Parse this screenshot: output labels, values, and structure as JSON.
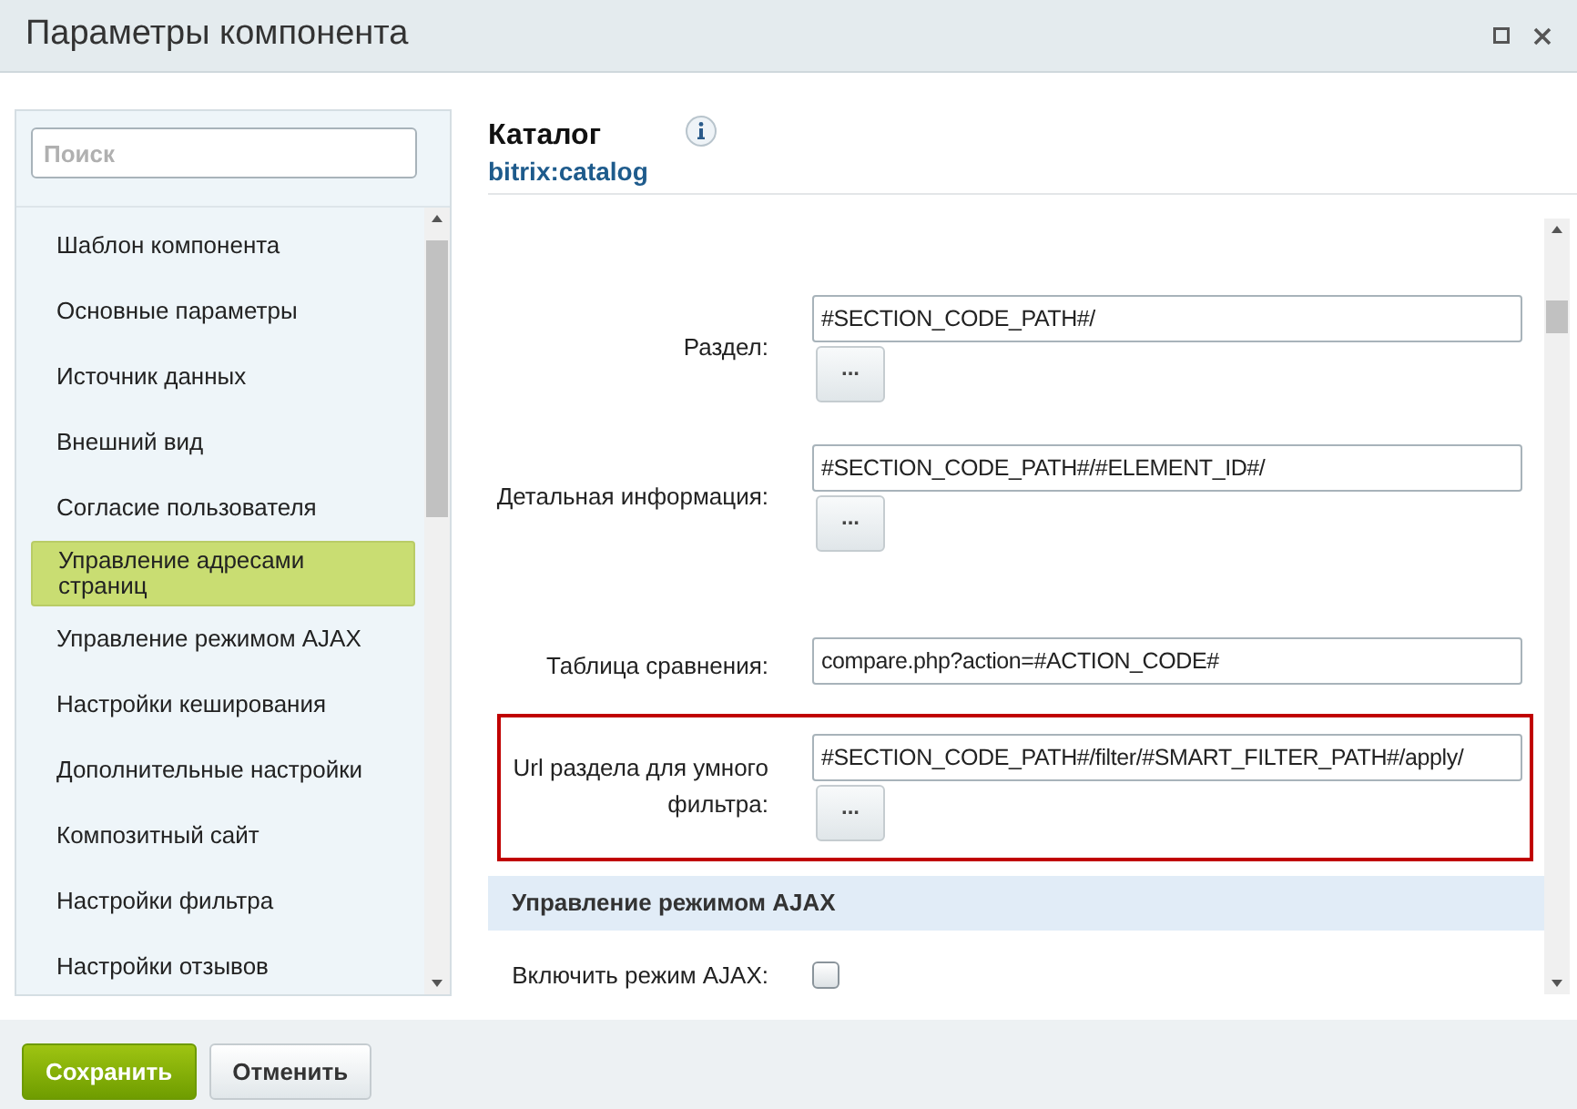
{
  "window": {
    "title": "Параметры компонента"
  },
  "sidebar": {
    "search": {
      "placeholder": "Поиск"
    },
    "items": [
      {
        "label": "Шаблон компонента",
        "selected": false
      },
      {
        "label": "Основные параметры",
        "selected": false
      },
      {
        "label": "Источник данных",
        "selected": false
      },
      {
        "label": "Внешний вид",
        "selected": false
      },
      {
        "label": "Согласие пользователя",
        "selected": false
      },
      {
        "label": "Управление адресами страниц",
        "selected": true
      },
      {
        "label": "Управление режимом AJAX",
        "selected": false
      },
      {
        "label": "Настройки кеширования",
        "selected": false
      },
      {
        "label": "Дополнительные настройки",
        "selected": false
      },
      {
        "label": "Композитный сайт",
        "selected": false
      },
      {
        "label": "Настройки фильтра",
        "selected": false
      },
      {
        "label": "Настройки отзывов",
        "selected": false
      }
    ]
  },
  "component": {
    "name": "Каталог",
    "code": "bitrix:catalog"
  },
  "rows": [
    {
      "kind": "field",
      "label": "Раздел:",
      "value": "#SECTION_CODE_PATH#/",
      "button": "...",
      "highlighted": false
    },
    {
      "kind": "field",
      "label": "Детальная информация:",
      "value": "#SECTION_CODE_PATH#/#ELEMENT_ID#/",
      "button": "...",
      "highlighted": false
    },
    {
      "kind": "field",
      "label": "Таблица сравнения:",
      "value": "compare.php?action=#ACTION_CODE#",
      "highlighted": false
    },
    {
      "kind": "field",
      "label": "Url раздела для умного фильтра:",
      "value": "#SECTION_CODE_PATH#/filter/#SMART_FILTER_PATH#/apply/",
      "button": "...",
      "highlighted": true
    },
    {
      "kind": "header",
      "label": "Управление режимом AJAX"
    },
    {
      "kind": "checkbox",
      "label": "Включить режим AJAX:",
      "checked": false
    }
  ],
  "buttons": [
    {
      "label": "Сохранить",
      "kind": "primary"
    },
    {
      "label": "Отменить",
      "kind": "secondary"
    }
  ]
}
